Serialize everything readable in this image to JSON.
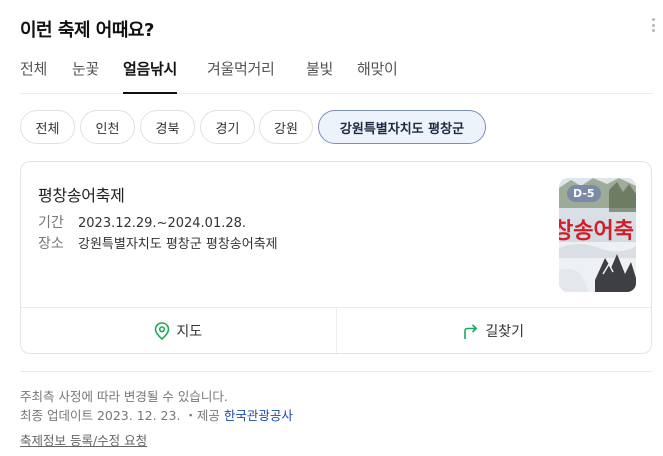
{
  "header": {
    "title": "이런 축제 어때요?"
  },
  "tabs": [
    {
      "label": "전체"
    },
    {
      "label": "눈꽃"
    },
    {
      "label": "얼음낚시"
    },
    {
      "label": "겨울먹거리"
    },
    {
      "label": "불빛"
    },
    {
      "label": "해맞이"
    }
  ],
  "active_tab": "얼음낚시",
  "regions": [
    {
      "label": "전체"
    },
    {
      "label": "인천"
    },
    {
      "label": "경북"
    },
    {
      "label": "경기"
    },
    {
      "label": "강원"
    },
    {
      "label": "강원특별자치도 평창군"
    }
  ],
  "active_region": "강원특별자치도 평창군",
  "festival": {
    "name": "평창송어축제",
    "period_label": "기간",
    "period": "2023.12.29.~2024.01.28.",
    "place_label": "장소",
    "place": "강원특별자치도 평창군 평창송어축제",
    "dday": "D-5",
    "poster_text": "창송어축"
  },
  "actions": {
    "map": {
      "label": "지도",
      "icon": "map-pin-icon"
    },
    "directions": {
      "label": "길찾기",
      "icon": "route-arrow-icon"
    }
  },
  "footer": {
    "note": "주최측 사정에 따라 변경될 수 있습니다.",
    "update_prefix": "최종 업데이트 2023. 12. 23.",
    "provider_prefix": "・제공",
    "provider": "한국관광공사",
    "request": "축제정보 등록/수정 요청"
  },
  "colors": {
    "accent_green": "#1fa85a",
    "chip_active_border": "#7b8fb8",
    "provider_link": "#1a4aa8"
  }
}
